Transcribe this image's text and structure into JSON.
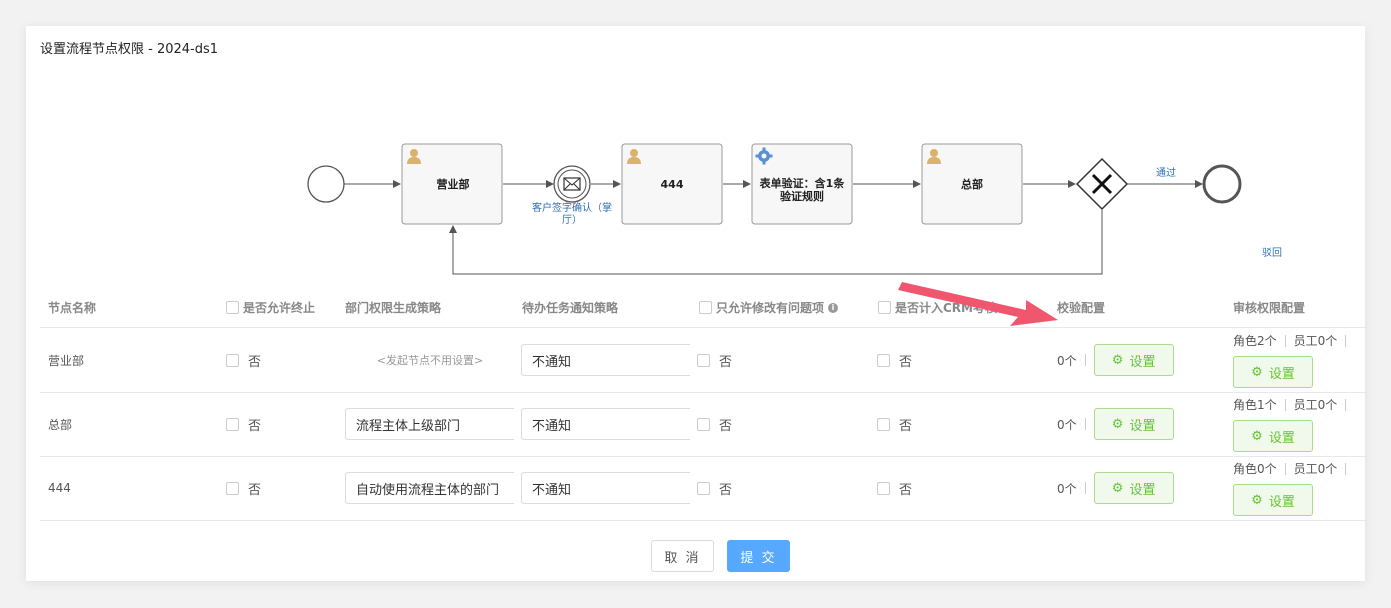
{
  "dialog": {
    "title": "设置流程节点权限 - 2024-ds1",
    "cancel_label": "取 消",
    "submit_label": "提 交"
  },
  "flow": {
    "nodes": {
      "sales": "营业部",
      "sign_line1": "客户签字确认（掌",
      "sign_line2": "厅）",
      "n444": "444",
      "validate_line1": "表单验证：含1条",
      "validate_line2": "验证规则",
      "hq": "总部"
    },
    "edges": {
      "pass": "通过",
      "reject": "驳回"
    }
  },
  "table": {
    "headers": {
      "name": "节点名称",
      "allow_terminate": "是否允许终止",
      "dept_policy": "部门权限生成策略",
      "todo_notify": "待办任务通知策略",
      "only_modify": "只允许修改有问题项",
      "crm": "是否计入CRM考核",
      "validation": "校验配置",
      "audit": "审核权限配置"
    },
    "rows": [
      {
        "name": "营业部",
        "allow_terminate": "否",
        "dept_policy": "",
        "dept_placeholder": "<发起节点不用设置>",
        "todo_notify": "不通知",
        "only_modify": "否",
        "crm": "否",
        "validation_count": "0个",
        "validation_btn": "设置",
        "roles": "角色2个",
        "staff": "员工0个",
        "audit_btn": "设置"
      },
      {
        "name": "总部",
        "allow_terminate": "否",
        "dept_policy": "流程主体上级部门",
        "dept_placeholder": "",
        "todo_notify": "不通知",
        "only_modify": "否",
        "crm": "否",
        "validation_count": "0个",
        "validation_btn": "设置",
        "roles": "角色1个",
        "staff": "员工0个",
        "audit_btn": "设置"
      },
      {
        "name": "444",
        "allow_terminate": "否",
        "dept_policy": "自动使用流程主体的部门",
        "dept_placeholder": "",
        "todo_notify": "不通知",
        "only_modify": "否",
        "crm": "否",
        "validation_count": "0个",
        "validation_btn": "设置",
        "roles": "角色0个",
        "staff": "员工0个",
        "audit_btn": "设置"
      }
    ]
  },
  "colors": {
    "accent_blue": "#57a8ff",
    "success_green": "#67c23a",
    "arrow_red": "#f1566f",
    "user_icon": "#d9b36c",
    "gear_icon": "#5b8fd6"
  }
}
